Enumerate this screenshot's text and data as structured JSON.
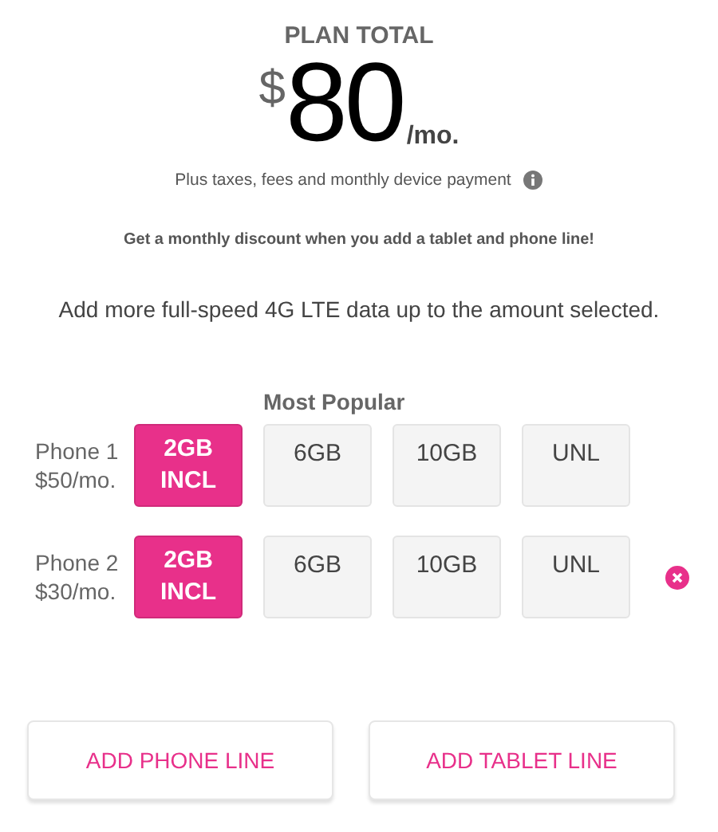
{
  "plan_total": {
    "heading": "PLAN TOTAL",
    "currency": "$",
    "amount": "80",
    "period": "/mo.",
    "note": "Plus taxes, fees and monthly device payment"
  },
  "discount_message": "Get a monthly discount when you add a tablet and phone line!",
  "data_prompt": "Add more full-speed 4G LTE data up to the amount selected.",
  "popular_label": "Most Popular",
  "lines": [
    {
      "name": "Phone 1",
      "price": "$50/mo.",
      "removable": false,
      "options": [
        {
          "label": "2GB INCL",
          "selected": true
        },
        {
          "label": "6GB",
          "selected": false
        },
        {
          "label": "10GB",
          "selected": false
        },
        {
          "label": "UNL",
          "selected": false
        }
      ]
    },
    {
      "name": "Phone 2",
      "price": "$30/mo.",
      "removable": true,
      "options": [
        {
          "label": "2GB INCL",
          "selected": true
        },
        {
          "label": "6GB",
          "selected": false
        },
        {
          "label": "10GB",
          "selected": false
        },
        {
          "label": "UNL",
          "selected": false
        }
      ]
    }
  ],
  "buttons": [
    "ADD PHONE LINE",
    "ADD TABLET LINE"
  ]
}
